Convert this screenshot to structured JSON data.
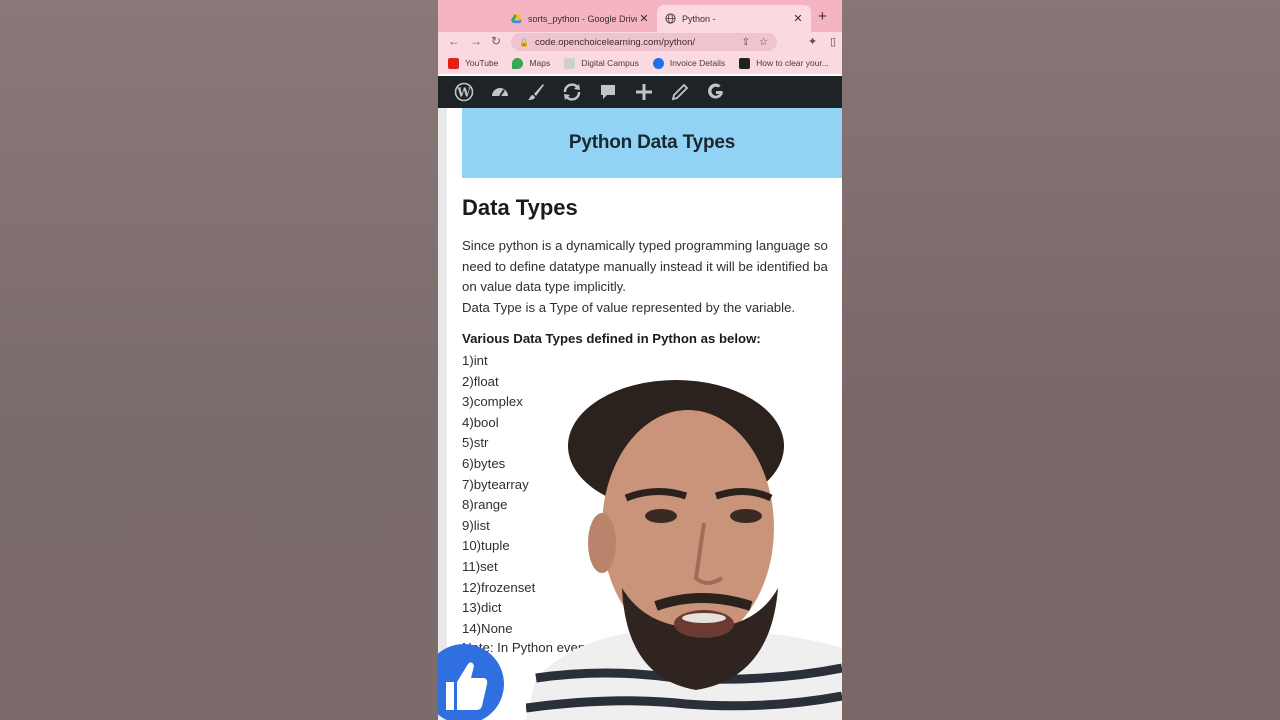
{
  "browser": {
    "tabs": [
      {
        "title": "sorts_python - Google Drive",
        "active": false,
        "icon": "google-drive-icon"
      },
      {
        "title": "Python -",
        "active": true,
        "icon": "globe-icon"
      }
    ],
    "url": "code.openchoicelearning.com/python/",
    "bookmarks": [
      {
        "label": "YouTube",
        "icon": "youtube-icon",
        "color": "#e62117"
      },
      {
        "label": "Maps",
        "icon": "maps-icon",
        "color": "#34a853"
      },
      {
        "label": "Digital Campus",
        "icon": "digital-campus-icon",
        "color": "#555555"
      },
      {
        "label": "Invoice Details",
        "icon": "invoice-icon",
        "color": "#1a73e8"
      },
      {
        "label": "How to clear your...",
        "icon": "article-icon",
        "color": "#222222"
      }
    ]
  },
  "page": {
    "hero_title": "Python Data Types",
    "heading": "Data Types",
    "paragraph_lines": [
      "Since python is a dynamically typed programming language so",
      "need to define datatype manually instead it will be identified ba",
      "on value data type implicitly.",
      "Data Type is a Type of value represented by the variable."
    ],
    "list_heading": "Various Data Types defined in Python as below:",
    "list_items": [
      "1)int",
      "2)float",
      "3)complex",
      "4)bool",
      "5)str",
      "6)bytes",
      "7)bytearray",
      "8)range",
      "9)list",
      "10)tuple",
      "11)set",
      "12)frozenset",
      "13)dict",
      "14)None"
    ],
    "note": "Note: In Python every thing is an"
  },
  "colors": {
    "hero_bg": "#92d3f5",
    "admin_bar": "#1d2327",
    "tab_strip": "#f4b4c2",
    "like_button": "#2f6fe0"
  }
}
